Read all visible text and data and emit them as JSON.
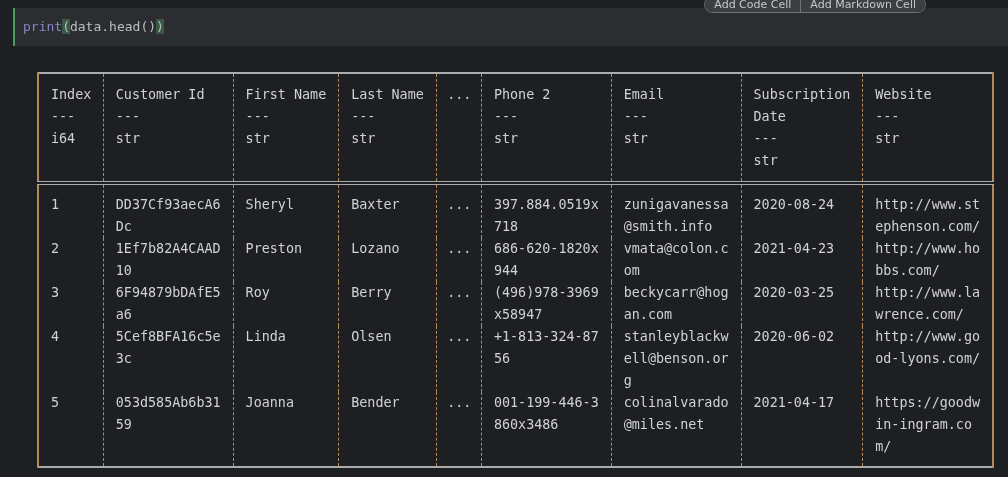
{
  "toolbar": {
    "buttons": [
      "Add Code Cell",
      "Add Markdown Cell"
    ]
  },
  "code_cell": {
    "tokens": [
      {
        "text": "print",
        "kind": "builtin"
      },
      {
        "text": "(",
        "kind": "match"
      },
      {
        "text": "data.head()",
        "kind": "plain"
      },
      {
        "text": ")",
        "kind": "match"
      }
    ]
  },
  "table": {
    "columns": [
      {
        "kind": "column",
        "name": "Index",
        "separator": "---",
        "dtype": "i64"
      },
      {
        "kind": "column",
        "name": "Customer Id",
        "separator": "---",
        "dtype": "str"
      },
      {
        "kind": "column",
        "name": "First Name",
        "separator": "---",
        "dtype": "str"
      },
      {
        "kind": "column",
        "name": "Last Name",
        "separator": "---",
        "dtype": "str"
      },
      {
        "kind": "ellipsis",
        "name": "..."
      },
      {
        "kind": "column",
        "name": "Phone 2",
        "separator": "---",
        "dtype": "str"
      },
      {
        "kind": "column",
        "name": "Email",
        "separator": "---",
        "dtype": "str"
      },
      {
        "kind": "column",
        "name": "Subscription Date",
        "separator": "---",
        "dtype": "str"
      },
      {
        "kind": "column",
        "name": "Website",
        "separator": "---",
        "dtype": "str"
      }
    ],
    "rows": [
      [
        "1",
        "DD37Cf93aecA6Dc",
        "Sheryl",
        "Baxter",
        "...",
        "397.884.0519x718",
        "zunigavanessa@smith.info",
        "2020-08-24",
        "http://www.stephenson.com/"
      ],
      [
        "2",
        "1Ef7b82A4CAAD10",
        "Preston",
        "Lozano",
        "...",
        "686-620-1820x944",
        "vmata@colon.com",
        "2021-04-23",
        "http://www.hobbs.com/"
      ],
      [
        "3",
        "6F94879bDAfE5a6",
        "Roy",
        "Berry",
        "...",
        "(496)978-3969x58947",
        "beckycarr@hogan.com",
        "2020-03-25",
        "http://www.lawrence.com/"
      ],
      [
        "4",
        "5Cef8BFA16c5e3c",
        "Linda",
        "Olsen",
        "...",
        "+1-813-324-8756",
        "stanleyblackwell@benson.org",
        "2020-06-02",
        "http://www.good-lyons.com/"
      ],
      [
        "5",
        "053d585Ab6b3159",
        "Joanna",
        "Bender",
        "...",
        "001-199-446-3860x3486",
        "colinalvarado@miles.net",
        "2021-04-17",
        "https://goodwin-ingram.com/"
      ]
    ]
  }
}
